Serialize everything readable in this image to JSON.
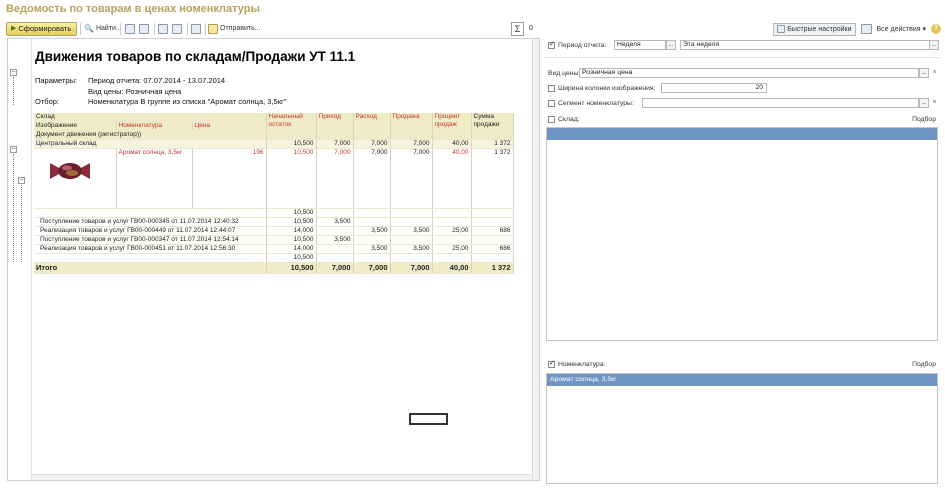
{
  "window": {
    "title": "Ведомость по товарам в ценах номенклатуры"
  },
  "toolbar": {
    "generate_label": "Сформировать",
    "find_label": "Найти...",
    "send_label": "Отправить...",
    "sum_symbol": "Σ",
    "sum_value": "0",
    "quick_settings_label": "Быстрые настройки",
    "all_actions_label": "Все действия ▾",
    "help_label": "?"
  },
  "report": {
    "title": "Движения товаров по складам/Продажи УТ 11.1",
    "params_label": "Параметры:",
    "params_period": "Период отчета: 07.07.2014 - 13.07.2014",
    "params_price": "Вид цены: Розничная цена",
    "filter_label": "Отбор:",
    "filter_value": "Номенклатура В группе из списка \"Аромат солнца, 3,5кг\"",
    "header": {
      "warehouse": "Склад",
      "image": "Изображение",
      "nomenclature": "Номенклатура",
      "price": "Цена",
      "document": "Документ движения (регистратор))",
      "opening": "Начальный остаток",
      "income": "Приход",
      "expense": "Расход",
      "sale": "Продажа",
      "percent": "Процент продаж",
      "sum": "Сумма продажи"
    },
    "group_row": {
      "name": "Центральный склад",
      "opening": "10,500",
      "income": "7,000",
      "expense": "7,000",
      "sale": "7,000",
      "percent": "40,00",
      "sum": "1 372"
    },
    "item_row": {
      "name": "Аромат солнца, 3,5кг",
      "price": "196",
      "opening": "10,500",
      "income": "7,000",
      "expense": "7,000",
      "sale": "7,000",
      "percent": "40,00",
      "sum": "1 372"
    },
    "doc_rows": [
      {
        "doc": "",
        "opening": "10,500",
        "income": "",
        "expense": "",
        "sale": "",
        "percent": "",
        "sum": ""
      },
      {
        "doc": "Поступление товаров и услуг ГВ00-000345 от 11.07.2014 12:40:32",
        "opening": "10,500",
        "income": "3,500",
        "expense": "",
        "sale": "",
        "percent": "",
        "sum": ""
      },
      {
        "doc": "Реализация товаров и услуг ГВ00-000449 от 11.07.2014 12:44:07",
        "opening": "14,000",
        "income": "",
        "expense": "3,500",
        "sale": "3,500",
        "percent": "25,00",
        "sum": "686"
      },
      {
        "doc": "Поступление товаров и услуг ГВ00-000347 от 11.07.2014 12:54:14",
        "opening": "10,500",
        "income": "3,500",
        "expense": "",
        "sale": "",
        "percent": "",
        "sum": ""
      },
      {
        "doc": "Реализация товаров и услуг ГВ00-000451 от 11.07.2014 12:56:30",
        "opening": "14,000",
        "income": "",
        "expense": "3,500",
        "sale": "3,500",
        "percent": "25,00",
        "sum": "686"
      },
      {
        "doc": "",
        "opening": "10,500",
        "income": "",
        "expense": "",
        "sale": "",
        "percent": "",
        "sum": ""
      }
    ],
    "total_row": {
      "label": "Итого",
      "opening": "10,500",
      "income": "7,000",
      "expense": "7,000",
      "sale": "7,000",
      "percent": "40,00",
      "sum": "1 372"
    }
  },
  "settings": {
    "period_label": "Период отчета:",
    "period_kind": "Неделя",
    "period_value": "Эта неделя",
    "price_label": "Вид цены:",
    "price_value": "Розничная цена",
    "image_width_label": "Ширина колонки изображения:",
    "image_width_value": "20",
    "segment_label": "Сегмент номенклатуры:",
    "segment_value": "",
    "warehouse_label": "Склад:",
    "warehouse_pick": "Подбор",
    "nomenclature_label": "Номенклатура:",
    "nomenclature_pick": "Подбор",
    "nomenclature_item": "Аромат солнца, 3,5кг"
  }
}
